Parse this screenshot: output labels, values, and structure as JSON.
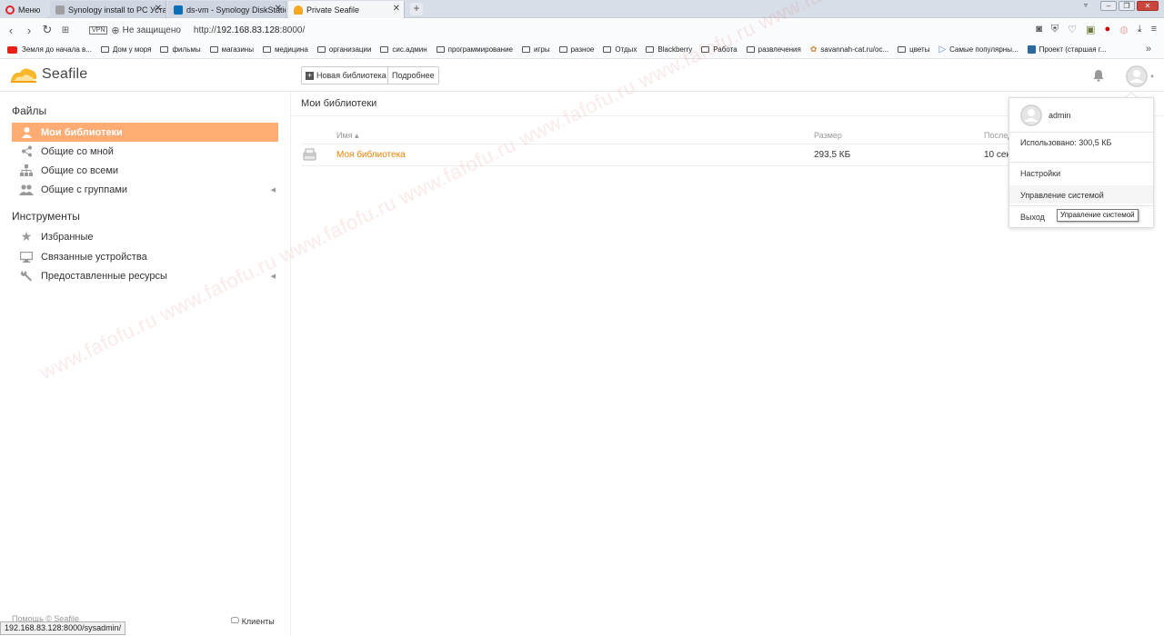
{
  "browser": {
    "menu_label": "Меню",
    "tabs": [
      {
        "title": "Synology install to PC Уста",
        "favicon_color": "#a0a0a0"
      },
      {
        "title": "ds-vm - Synology DiskStatio",
        "favicon_color": "#0a6fb7"
      },
      {
        "title": "Private Seafile",
        "favicon_color": "#f5a623"
      }
    ],
    "window_controls": [
      "▿",
      "–",
      "❐",
      "✕"
    ],
    "vpn_label": "VPN",
    "security_text": "Не защищено",
    "url_prefix": "http://",
    "url_host": "192.168.83.128",
    "url_rest": ":8000/",
    "bookmarks": [
      "Земля до начала в...",
      "Дом у моря",
      "фильмы",
      "магазины",
      "медицина",
      "организации",
      "сис.админ",
      "программирование",
      "игры",
      "разное",
      "Отдых",
      "Blackberry",
      "Работа",
      "развлечения",
      "savannah-cat.ru/ос...",
      "цветы",
      "Самые популярны...",
      "Проект (старшая г..."
    ],
    "bookmarks_more": "»"
  },
  "header": {
    "logo_text": "Seafile",
    "new_library_label": "Новая библиотека",
    "details_label": "Подробнее"
  },
  "sidebar": {
    "files_heading": "Файлы",
    "files_items": [
      {
        "label": "Мои библиотеки",
        "icon": "user-icon"
      },
      {
        "label": "Общие со мной",
        "icon": "share-icon"
      },
      {
        "label": "Общие со всеми",
        "icon": "org-icon"
      },
      {
        "label": "Общие с группами",
        "icon": "group-icon"
      }
    ],
    "tools_heading": "Инструменты",
    "tools_items": [
      {
        "label": "Избранные",
        "icon": "star-icon"
      },
      {
        "label": "Связанные устройства",
        "icon": "monitor-icon"
      },
      {
        "label": "Предоставленные ресурсы",
        "icon": "wrench-icon"
      }
    ],
    "footer_left": "Помощь © Seafile",
    "footer_right": "Клиенты"
  },
  "main": {
    "title": "Мои библиотеки",
    "columns": {
      "name": "Имя ▴",
      "size": "Размер",
      "modified": "Послед"
    },
    "rows": [
      {
        "name": "Моя библиотека",
        "size": "293,5 КБ",
        "modified": "10 сек"
      }
    ]
  },
  "dropdown": {
    "username": "admin",
    "usage": "Использовано: 300,5 КБ",
    "settings": "Настройки",
    "system_admin": "Управление системой",
    "logout": "Выход",
    "tooltip": "Управление системой"
  },
  "status_url": "192.168.83.128:8000/sysadmin/",
  "watermark": "www.fafofu.ru www.fafofu.ru www.fafofu.ru www.fafofu.ru www.fafofu.ru www.fafofu.ru www.fafofu.ru",
  "colors": {
    "accent": "#feac74",
    "link": "#eb8205"
  }
}
